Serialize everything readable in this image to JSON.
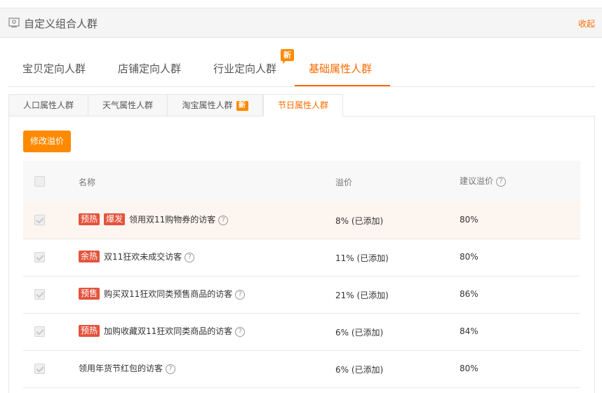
{
  "header": {
    "title": "自定义组合人群",
    "collapse_label": "收起"
  },
  "main_tabs": {
    "items": [
      {
        "label": "宝贝定向人群"
      },
      {
        "label": "店铺定向人群"
      },
      {
        "label": "行业定向人群",
        "badge": "新"
      },
      {
        "label": "基础属性人群",
        "active": true
      }
    ]
  },
  "sub_tabs": {
    "items": [
      {
        "label": "人口属性人群"
      },
      {
        "label": "天气属性人群"
      },
      {
        "label": "淘宝属性人群",
        "badge": "新"
      },
      {
        "label": "节日属性人群",
        "active": true
      }
    ]
  },
  "toolbar": {
    "edit_button": "修改溢价"
  },
  "table": {
    "columns": {
      "name": "名称",
      "premium": "溢价",
      "suggested": "建议溢价"
    },
    "rows": [
      {
        "tags": [
          "预热",
          "爆发"
        ],
        "name": "领用双11购物券的访客",
        "premium": "8% (已添加)",
        "suggested": "80%"
      },
      {
        "tags": [
          "余热"
        ],
        "name": "双11狂欢未成交访客",
        "premium": "11% (已添加)",
        "suggested": "80%"
      },
      {
        "tags": [
          "预售"
        ],
        "name": "购买双11狂欢同类预售商品的访客",
        "premium": "21% (已添加)",
        "suggested": "86%"
      },
      {
        "tags": [
          "预热"
        ],
        "name": "加购收藏双11狂欢同类商品的访客",
        "premium": "6% (已添加)",
        "suggested": "84%"
      },
      {
        "tags": [],
        "name": "领用年货节红包的访客",
        "premium": "6% (已添加)",
        "suggested": "80%"
      }
    ]
  },
  "colors": {
    "accent": "#ff6a00",
    "button": "#ff8a00",
    "tag": "#e5533d",
    "highlight_row": "#fdf5f0"
  },
  "icons": {
    "panel": "panel-icon",
    "help": "help-icon"
  }
}
